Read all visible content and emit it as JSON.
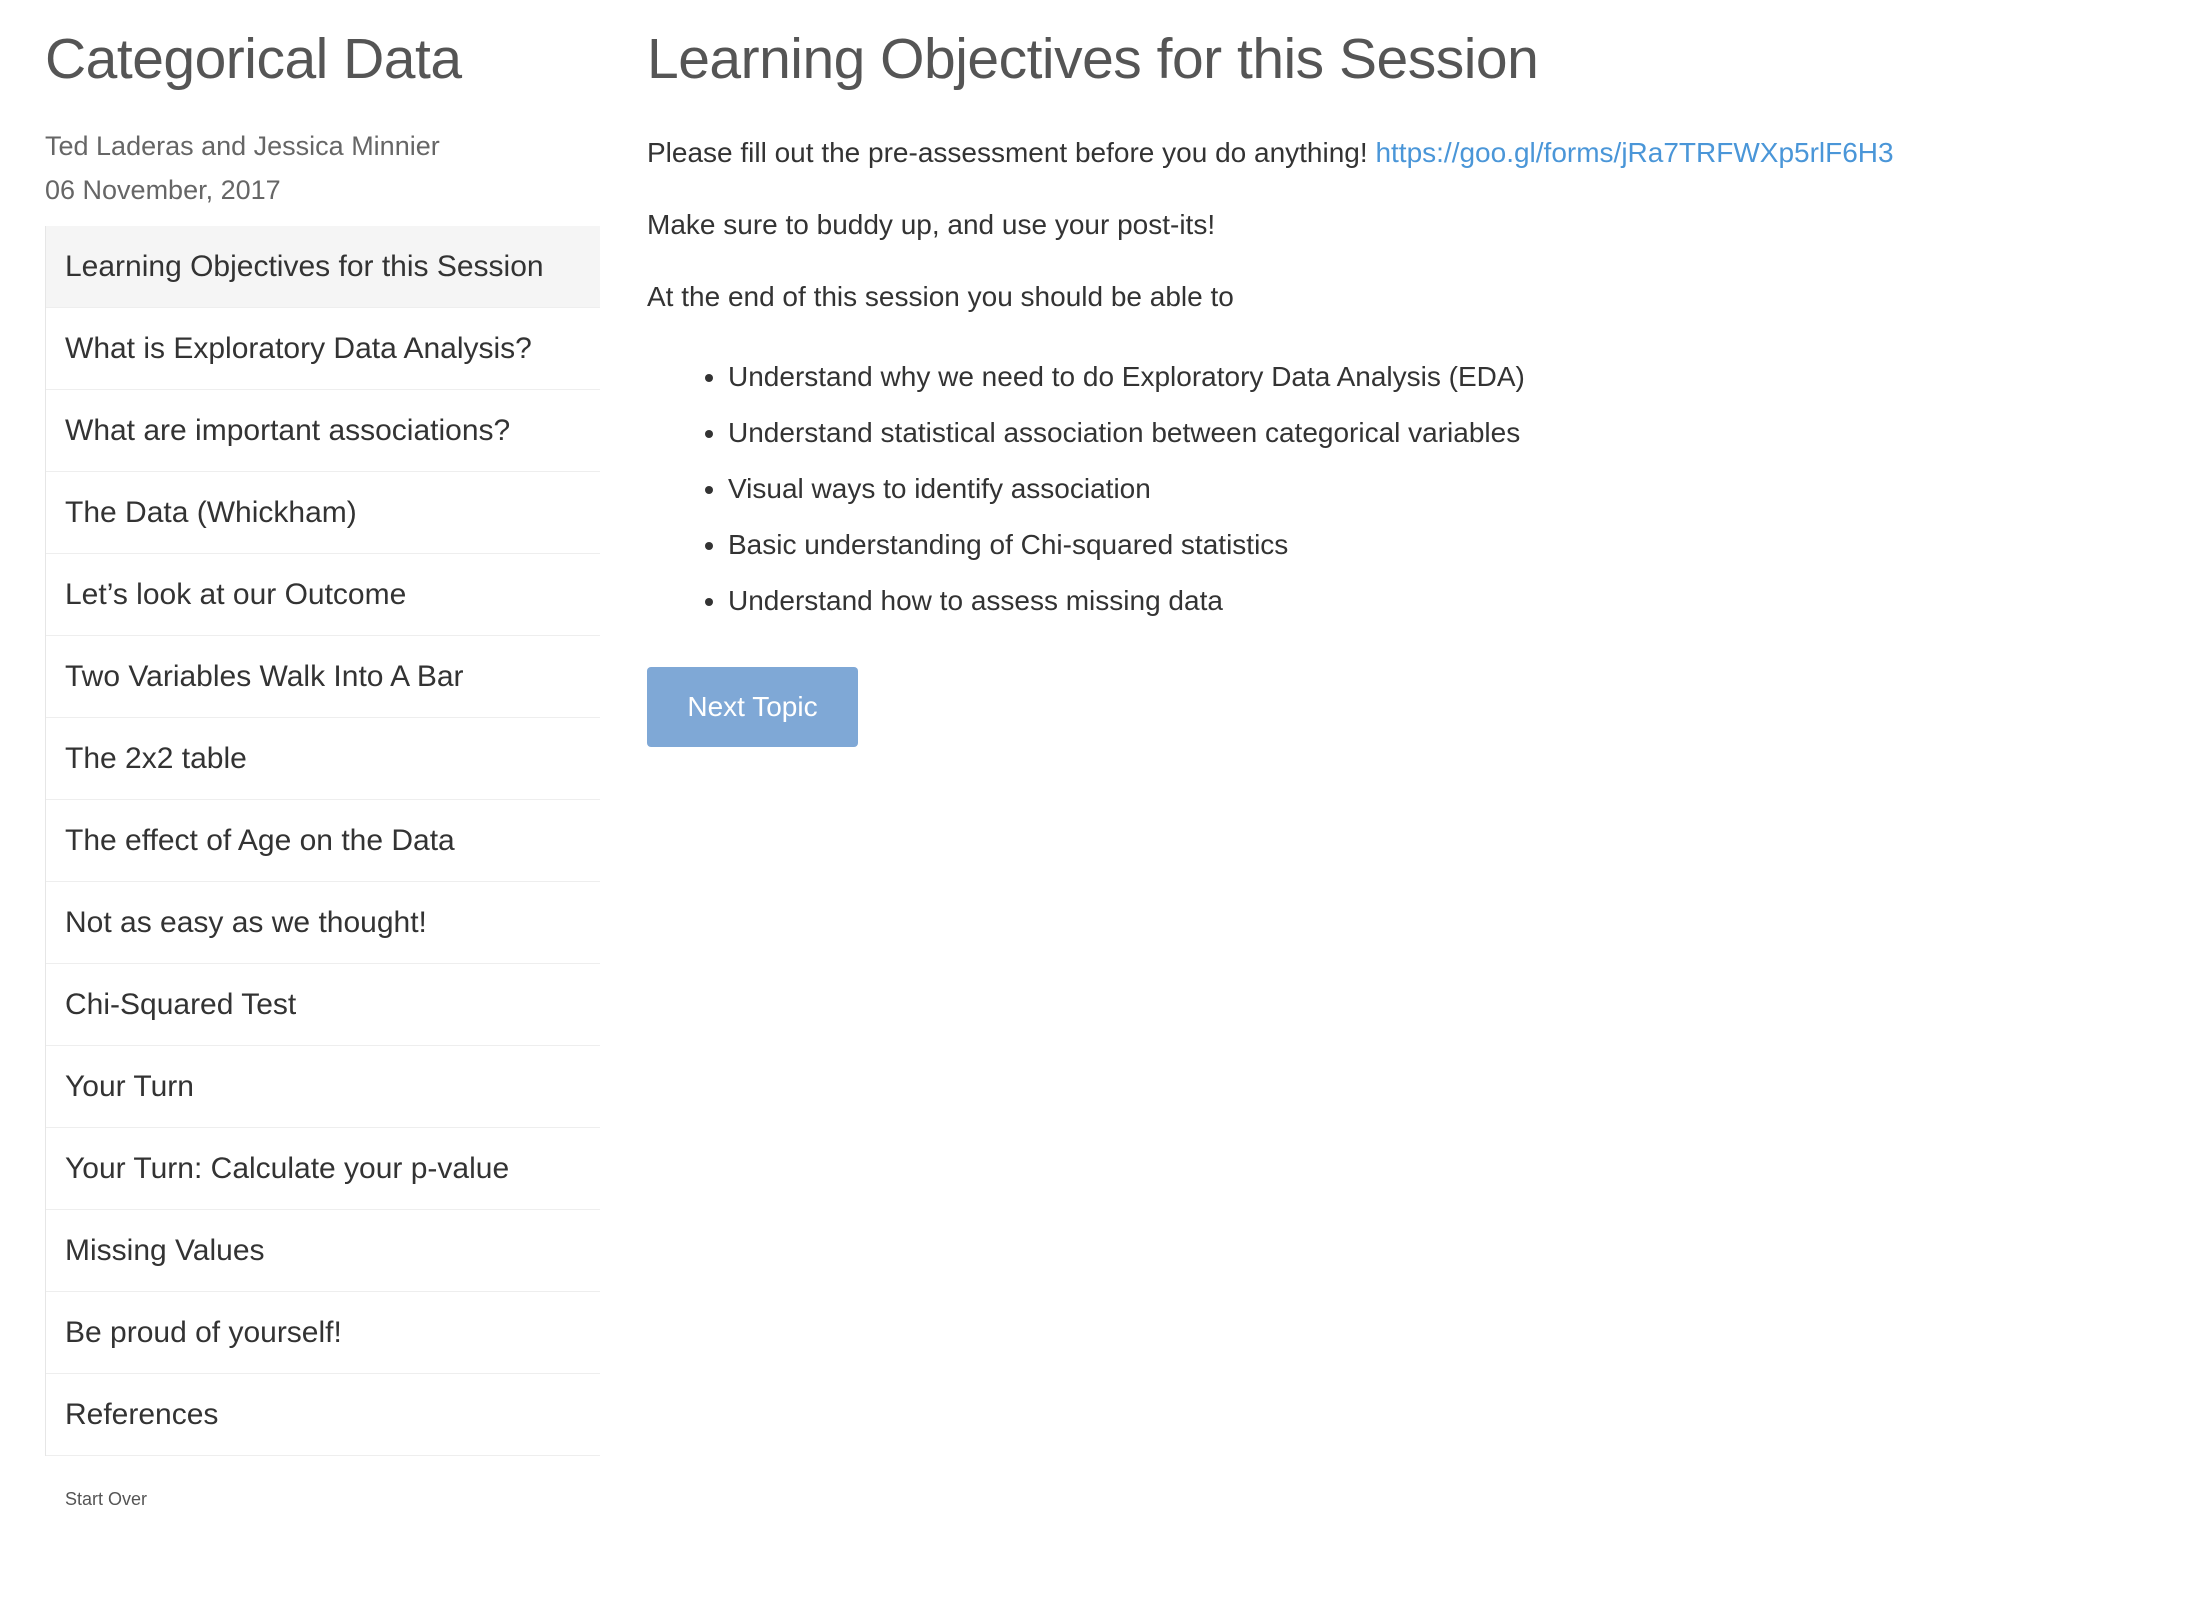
{
  "sidebar": {
    "title": "Categorical Data",
    "author": "Ted Laderas and Jessica Minnier",
    "date": "06 November, 2017",
    "items": [
      {
        "label": "Learning Objectives for this Session",
        "active": true
      },
      {
        "label": "What is Exploratory Data Analysis?",
        "active": false
      },
      {
        "label": "What are important associations?",
        "active": false
      },
      {
        "label": "The Data (Whickham)",
        "active": false
      },
      {
        "label": "Let’s look at our Outcome",
        "active": false
      },
      {
        "label": "Two Variables Walk Into A Bar",
        "active": false
      },
      {
        "label": "The 2x2 table",
        "active": false
      },
      {
        "label": "The effect of Age on the Data",
        "active": false
      },
      {
        "label": "Not as easy as we thought!",
        "active": false
      },
      {
        "label": "Chi-Squared Test",
        "active": false
      },
      {
        "label": "Your Turn",
        "active": false
      },
      {
        "label": "Your Turn: Calculate your p-value",
        "active": false
      },
      {
        "label": "Missing Values",
        "active": false
      },
      {
        "label": "Be proud of yourself!",
        "active": false
      },
      {
        "label": "References",
        "active": false
      }
    ],
    "start_over": "Start Over"
  },
  "main": {
    "title": "Learning Objectives for this Session",
    "intro_text": "Please fill out the pre-assessment before you do anything!",
    "link_text": "https://goo.gl/forms/jRa7TRFWXp5rlF6H3",
    "buddy_text": "Make sure to buddy up, and use your post-its!",
    "lead_text": "At the end of this session you should be able to",
    "objectives": [
      "Understand why we need to do Exploratory Data Analysis (EDA)",
      "Understand statistical association between categorical variables",
      "Visual ways to identify association",
      "Basic understanding of Chi-squared statistics",
      "Understand how to assess missing data"
    ],
    "next_button": "Next Topic"
  },
  "colors": {
    "link": "#4a96d8",
    "button_bg": "#7fa8d6",
    "active_item_bg": "#f5f5f5",
    "text": "#333333"
  }
}
